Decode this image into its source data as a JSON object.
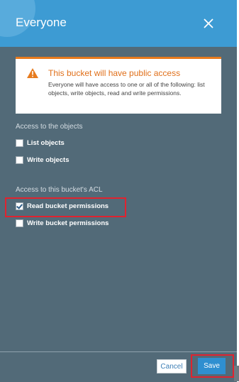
{
  "dialog": {
    "title": "Everyone",
    "close_icon": "close-icon"
  },
  "alert": {
    "icon": "warning-icon",
    "title": "This bucket will have public access",
    "body": "Everyone will have access to one or all of the following: list objects, write objects, read and write permissions."
  },
  "objects_section": {
    "title": "Access to the objects",
    "options": [
      {
        "label": "List objects",
        "checked": false
      },
      {
        "label": "Write objects",
        "checked": false
      }
    ]
  },
  "acl_section": {
    "title": "Access to this bucket's ACL",
    "options": [
      {
        "label": "Read bucket permissions",
        "checked": true
      },
      {
        "label": "Write bucket permissions",
        "checked": false
      }
    ]
  },
  "footer": {
    "cancel_label": "Cancel",
    "save_label": "Save"
  },
  "colors": {
    "header": "#3d9bd3",
    "panel": "#526a78",
    "alert_accent": "#e77b1e",
    "highlight": "#e0232f",
    "primary_button": "#2f8fd0"
  }
}
